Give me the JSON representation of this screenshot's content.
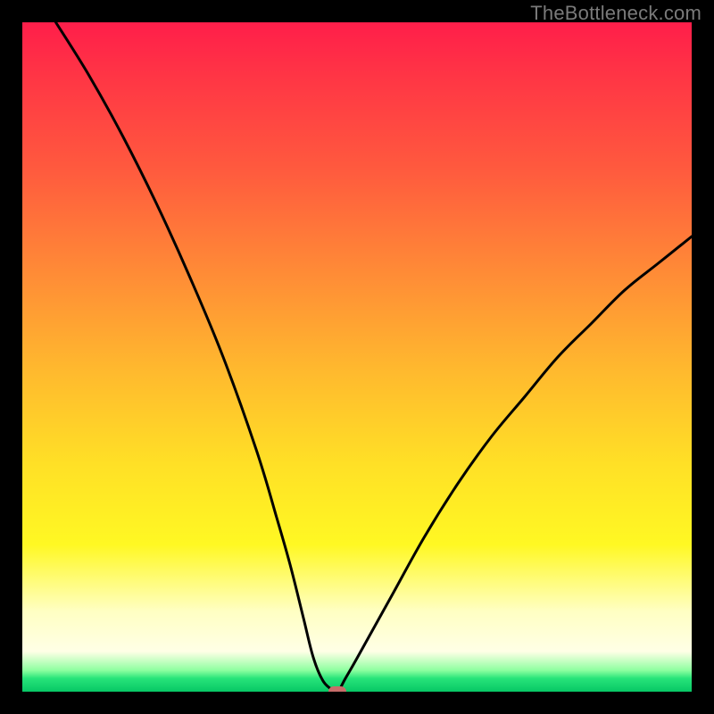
{
  "watermark": "TheBottleneck.com",
  "chart_data": {
    "type": "line",
    "title": "",
    "xlabel": "",
    "ylabel": "",
    "xlim": [
      0,
      100
    ],
    "ylim": [
      0,
      100
    ],
    "grid": false,
    "legend": false,
    "gradient_stops": [
      {
        "pos": 0.0,
        "color": "#ff1e4a"
      },
      {
        "pos": 0.08,
        "color": "#ff3545"
      },
      {
        "pos": 0.22,
        "color": "#ff5a3e"
      },
      {
        "pos": 0.38,
        "color": "#ff8d36"
      },
      {
        "pos": 0.52,
        "color": "#ffb92e"
      },
      {
        "pos": 0.66,
        "color": "#ffe026"
      },
      {
        "pos": 0.78,
        "color": "#fff823"
      },
      {
        "pos": 0.88,
        "color": "#ffffc3"
      },
      {
        "pos": 0.94,
        "color": "#ffffe6"
      },
      {
        "pos": 0.968,
        "color": "#8effa0"
      },
      {
        "pos": 0.98,
        "color": "#28e47a"
      },
      {
        "pos": 1.0,
        "color": "#07c765"
      }
    ],
    "series": [
      {
        "name": "bottleneck-curve",
        "x": [
          5,
          10,
          15,
          20,
          25,
          30,
          35,
          38,
          40,
          42,
          43.5,
          45,
          46.7,
          47.3,
          48,
          50,
          55,
          60,
          65,
          70,
          75,
          80,
          85,
          90,
          95,
          100
        ],
        "y": [
          100,
          92,
          83,
          73,
          62,
          50,
          36,
          26,
          19,
          11,
          5,
          1.5,
          0,
          0,
          1.5,
          5,
          14,
          23,
          31,
          38,
          44,
          50,
          55,
          60,
          64,
          68
        ]
      }
    ],
    "marker": {
      "x": 47,
      "y": 0,
      "color": "#c76d6a"
    }
  }
}
